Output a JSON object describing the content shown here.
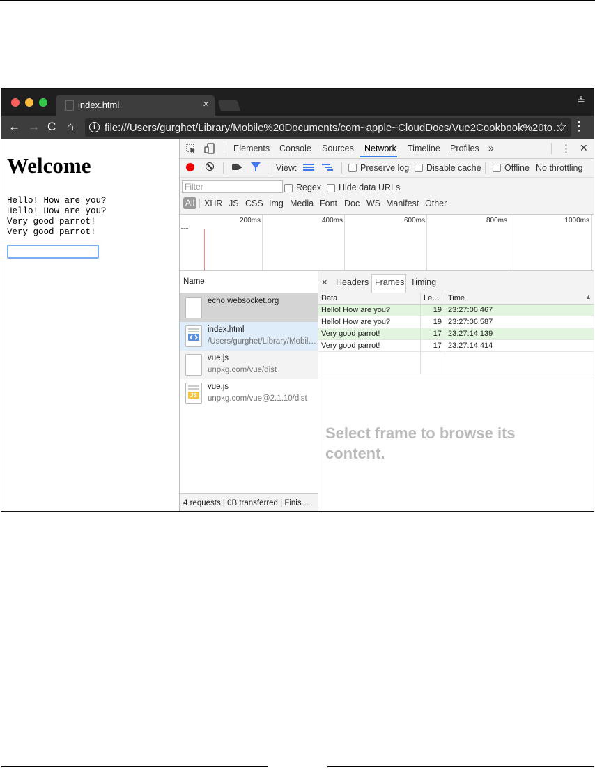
{
  "browser": {
    "tab_title": "index.html",
    "tab_close": "×",
    "url": "file:///Users/gurghet/Library/Mobile%20Documents/com~apple~CloudDocs/Vue2Cookbook%20to…",
    "info_glyph": "i",
    "nav": {
      "back": "←",
      "forward": "→",
      "reload": "C",
      "home": "⌂"
    },
    "star": "☆",
    "menu": "⋮",
    "incognito": "≗"
  },
  "page": {
    "heading": "Welcome",
    "messages": [
      "Hello! How are you?",
      "Hello! How are you?",
      "Very good parrot!",
      "Very good parrot!"
    ],
    "input_value": ""
  },
  "devtools": {
    "tabs": [
      "Elements",
      "Console",
      "Sources",
      "Network",
      "Timeline",
      "Profiles"
    ],
    "active_tab": "Network",
    "more": "»",
    "menu": "⋮",
    "close": "✕",
    "controls": {
      "view_label": "View:",
      "preserve_log": "Preserve log",
      "disable_cache": "Disable cache",
      "offline": "Offline",
      "throttling": "No throttling"
    },
    "filter": {
      "placeholder": "Filter",
      "regex": "Regex",
      "hide_data_urls": "Hide data URLs",
      "types": [
        "All",
        "XHR",
        "JS",
        "CSS",
        "Img",
        "Media",
        "Font",
        "Doc",
        "WS",
        "Manifest",
        "Other"
      ]
    },
    "overview_ticks": [
      "200ms",
      "400ms",
      "600ms",
      "800ms",
      "1000ms"
    ],
    "requests": {
      "header": "Name",
      "items": [
        {
          "name": "echo.websocket.org",
          "path": ""
        },
        {
          "name": "index.html",
          "path": "/Users/gurghet/Library/Mobil…"
        },
        {
          "name": "vue.js",
          "path": "unpkg.com/vue/dist"
        },
        {
          "name": "vue.js",
          "path": "unpkg.com/vue@2.1.10/dist"
        }
      ],
      "status": "4 requests | 0B transferred | Finis…"
    },
    "frames": {
      "close": "×",
      "tabs": [
        "Headers",
        "Frames",
        "Timing"
      ],
      "active_tab": "Frames",
      "columns": [
        "Data",
        "Le…",
        "Time"
      ],
      "rows": [
        {
          "data": "Hello! How are you?",
          "length": "19",
          "time": "23:27:06.467",
          "direction": "sent"
        },
        {
          "data": "Hello! How are you?",
          "length": "19",
          "time": "23:27:06.587",
          "direction": "received"
        },
        {
          "data": "Very good parrot!",
          "length": "17",
          "time": "23:27:14.139",
          "direction": "sent"
        },
        {
          "data": "Very good parrot!",
          "length": "17",
          "time": "23:27:14.414",
          "direction": "received"
        }
      ],
      "placeholder": "Select frame to browse its content."
    }
  },
  "colors": {
    "accent": "#3b7ae8",
    "sent_row": "#e2f5de",
    "record": "#ee0000"
  }
}
